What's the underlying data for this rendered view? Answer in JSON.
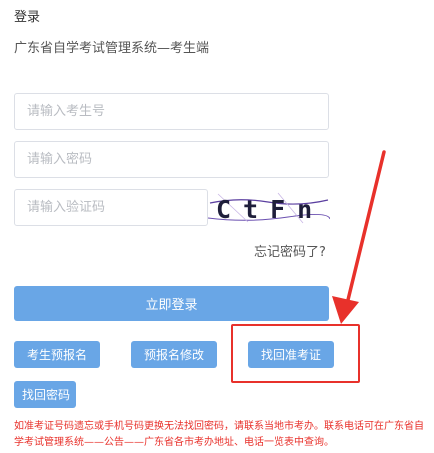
{
  "header": {
    "title": "登录",
    "subtitle": "广东省自学考试管理系统—考生端"
  },
  "form": {
    "candidate_id_placeholder": "请输入考生号",
    "password_placeholder": "请输入密码",
    "captcha_placeholder": "请输入验证码",
    "captcha_text": "CtFn",
    "forgot_password": "忘记密码了?",
    "login_button": "立即登录"
  },
  "actions": {
    "pre_register": "考生预报名",
    "modify_pre_register": "预报名修改",
    "retrieve_admission": "找回准考证",
    "retrieve_password": "找回密码"
  },
  "notice": "如准考证号码遗忘或手机号码更换无法找回密码，请联系当地市考办。联系电话可在广东省自学考试管理系统——公告——广东省各市考办地址、电话一览表中查询。",
  "colors": {
    "primary": "#69a6e6",
    "annotation_red": "#e8312b",
    "notice_red": "#e8312b"
  }
}
